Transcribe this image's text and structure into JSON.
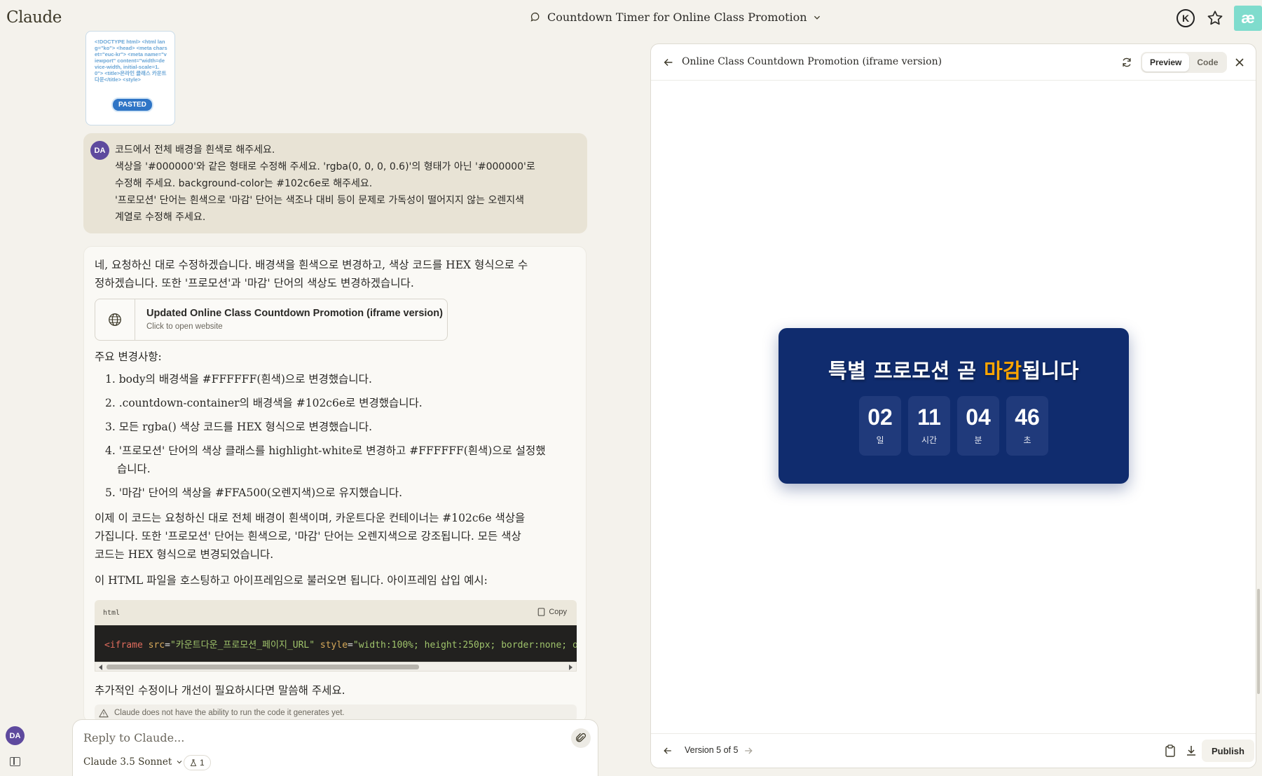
{
  "app": {
    "logo": "Claude"
  },
  "header": {
    "conversation_title": "Countdown Timer for Online Class Promotion",
    "profile_initial": "K",
    "app_badge": "æ"
  },
  "pasted": {
    "snippet": "<!DOCTYPE html> <html lang=\"ko\"> <head> <meta charset=\"euc-kr\"> <meta name=\"viewport\" content=\"width=device-width, initial-scale=1.0\"> <title>온라인 클래스 카운트다운</title> <style>",
    "badge": "PASTED"
  },
  "user_message": {
    "avatar": "DA",
    "lines": [
      "코드에서 전체 배경을 흰색로 해주세요.",
      "색상을 '#000000'와 같은 형태로 수정해 주세요. 'rgba(0, 0, 0, 0.6)'의 형태가 아닌 '#000000'로",
      "수정해 주세요. background-color는 #102c6e로 해주세요.",
      "'프로모션' 단어는 흰색으로 '마감' 단어는 색조나 대비 등이 문제로 가독성이 떨어지지 않는 오렌지색",
      "계열로 수정해 주세요."
    ]
  },
  "assistant": {
    "intro_1": "네, 요청하신 대로 수정하겠습니다. 배경색을 흰색으로 변경하고, 색상 코드를 HEX 형식으로 수",
    "intro_2": "정하겠습니다. 또한 '프로모션'과 '마감' 단어의 색상도 변경하겠습니다.",
    "artifact": {
      "title": "Updated Online Class Countdown Promotion (iframe version)",
      "subtitle": "Click to open website"
    },
    "changes_heading": "주요 변경사항:",
    "changes": [
      "1. body의 배경색을 #FFFFFF(흰색)으로 변경했습니다.",
      "2. .countdown-container의 배경색을 #102c6e로 변경했습니다.",
      "3. 모든 rgba() 색상 코드를 HEX 형식으로 변경했습니다.",
      "4. '프로모션' 단어의 색상 클래스를 highlight-white로 변경하고 #FFFFFF(흰색)으로 설정했",
      "습니다.",
      "5. '마감' 단어의 색상을 #FFA500(오렌지색)으로 유지했습니다."
    ],
    "summary_1": "이제 이 코드는 요청하신 대로 전체 배경이 흰색이며, 카운트다운 컨테이너는 #102c6e 색상을",
    "summary_2": "가집니다. 또한 '프로모션' 단어는 흰색으로, '마감' 단어는 오렌지색으로 강조됩니다. 모든 색상",
    "summary_3": "코드는 HEX 형식으로 변경되었습니다.",
    "iframe_note": "이 HTML 파일을 호스팅하고 아이프레임으로 불러오면 됩니다. 아이프레임 삽입 예시:",
    "code": {
      "lang": "html",
      "copy_label": "Copy",
      "tag_open": "<iframe",
      "attr_src": "src",
      "src_value": "\"카운트다운_프로모션_페이지_URL\"",
      "attr_style": "style",
      "style_value": "\"width:100%; height:250px; border:none; o"
    },
    "closing": "추가적인 수정이나 개선이 필요하시다면 말씀해 주세요.",
    "warning": "Claude does not have the ability to run the code it generates yet."
  },
  "composer": {
    "placeholder": "Reply to Claude...",
    "model": "Claude 3.5 Sonnet",
    "chip_count": "1"
  },
  "sidebar": {
    "user_avatar": "DA"
  },
  "panel": {
    "title": "Online Class Countdown Promotion (iframe version)",
    "tab_preview": "Preview",
    "tab_code": "Code",
    "countdown": {
      "title_part1": "특별 프로모션 곧 ",
      "title_highlight": "마감",
      "title_part2": "됩니다",
      "highlight_color": "#FFA500",
      "bg_color": "#102c6e",
      "units": [
        {
          "value": "02",
          "label": "일"
        },
        {
          "value": "11",
          "label": "시간"
        },
        {
          "value": "04",
          "label": "분"
        },
        {
          "value": "46",
          "label": "초"
        }
      ]
    },
    "version": "Version 5 of 5",
    "publish": "Publish"
  }
}
